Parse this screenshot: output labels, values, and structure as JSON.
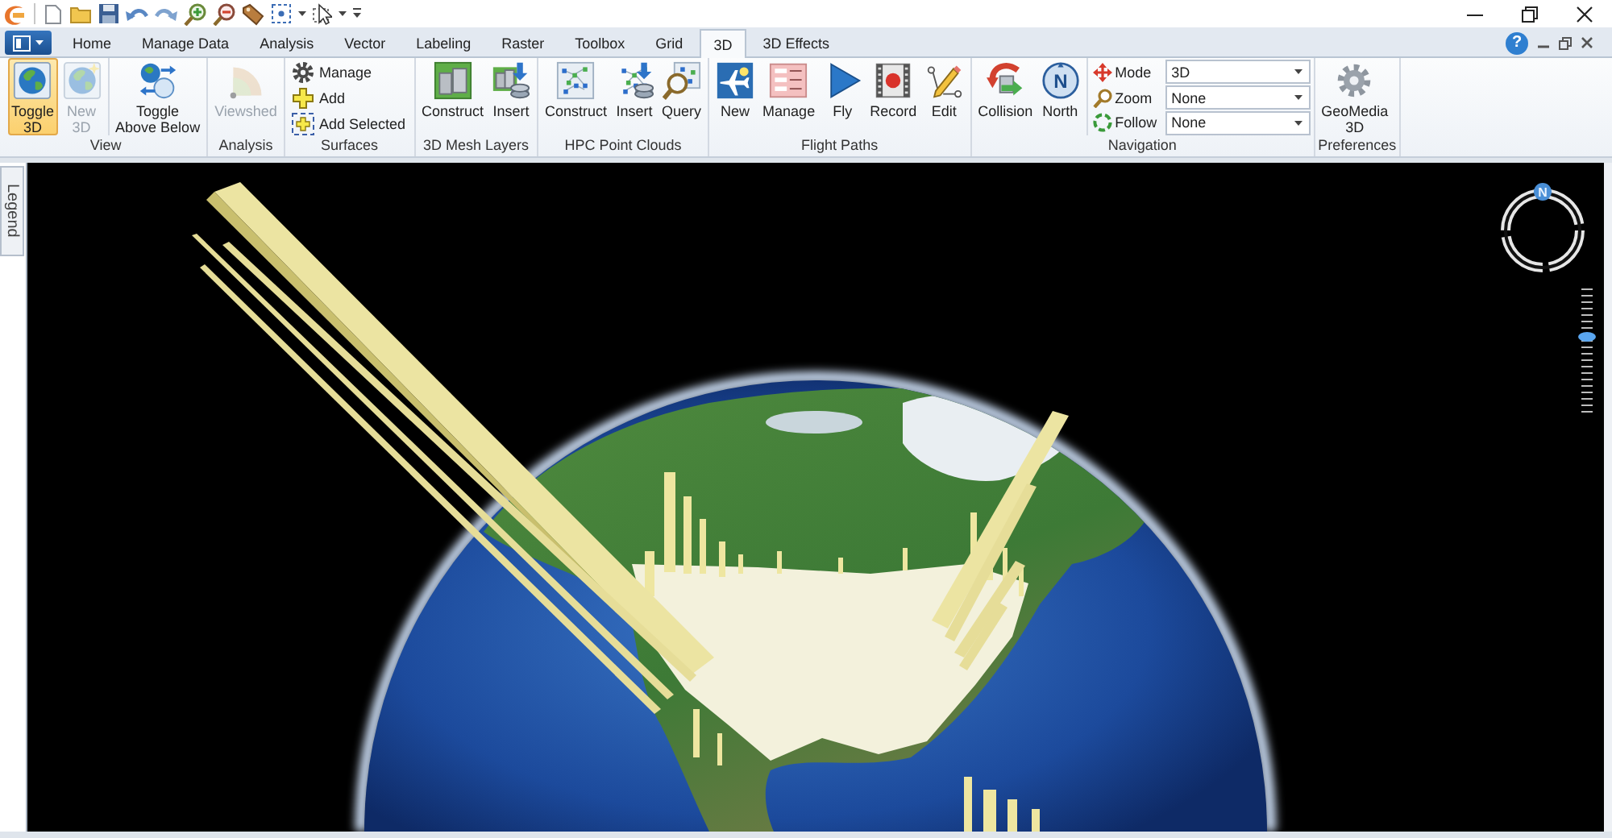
{
  "tabs": [
    {
      "label": "Home",
      "selected": false
    },
    {
      "label": "Manage Data",
      "selected": false
    },
    {
      "label": "Analysis",
      "selected": false
    },
    {
      "label": "Vector",
      "selected": false
    },
    {
      "label": "Labeling",
      "selected": false
    },
    {
      "label": "Raster",
      "selected": false
    },
    {
      "label": "Toolbox",
      "selected": false
    },
    {
      "label": "Grid",
      "selected": false
    },
    {
      "label": "3D",
      "selected": true
    },
    {
      "label": "3D Effects",
      "selected": false
    }
  ],
  "help_button": {
    "glyph": "?"
  },
  "ribbon": [
    {
      "label": "View",
      "sections": [
        {
          "items": [
            {
              "kind": "large",
              "label": "Toggle\n3D",
              "on": true,
              "disabled": false
            },
            {
              "kind": "large",
              "label": "New\n3D",
              "on": false,
              "disabled": true
            }
          ]
        },
        {
          "items": [
            {
              "kind": "large",
              "label": "Toggle\nAbove Below",
              "on": false,
              "disabled": false
            }
          ]
        }
      ]
    },
    {
      "label": "Analysis",
      "sections": [
        {
          "items": [
            {
              "kind": "large",
              "label": "Viewshed",
              "on": false,
              "disabled": true
            }
          ]
        }
      ]
    },
    {
      "label": "Surfaces",
      "sections": [
        {
          "items": [
            {
              "kind": "small",
              "label": "Manage",
              "on": false,
              "disabled": false
            },
            {
              "kind": "small",
              "label": "Add",
              "on": false,
              "disabled": false
            },
            {
              "kind": "small",
              "label": "Add Selected",
              "on": false,
              "disabled": false
            }
          ]
        }
      ]
    },
    {
      "label": "3D Mesh Layers",
      "sections": [
        {
          "items": [
            {
              "kind": "large",
              "label": "Construct",
              "on": false,
              "disabled": false
            },
            {
              "kind": "large",
              "label": "Insert",
              "on": false,
              "disabled": false
            }
          ]
        }
      ]
    },
    {
      "label": "HPC Point Clouds",
      "sections": [
        {
          "items": [
            {
              "kind": "large",
              "label": "Construct",
              "on": false,
              "disabled": false
            },
            {
              "kind": "large",
              "label": "Insert",
              "on": false,
              "disabled": false
            },
            {
              "kind": "large",
              "label": "Query",
              "on": false,
              "disabled": false
            }
          ]
        }
      ]
    },
    {
      "label": "Flight Paths",
      "sections": [
        {
          "items": [
            {
              "kind": "large",
              "label": "New",
              "on": false,
              "disabled": false
            },
            {
              "kind": "large",
              "label": "Manage",
              "on": false,
              "disabled": false
            },
            {
              "kind": "large",
              "label": "Fly",
              "on": false,
              "disabled": false
            },
            {
              "kind": "large",
              "label": "Record",
              "on": false,
              "disabled": false
            },
            {
              "kind": "large",
              "label": "Edit",
              "on": false,
              "disabled": false
            }
          ]
        }
      ]
    },
    {
      "label": "Navigation",
      "sections": [
        {
          "items": [
            {
              "kind": "large",
              "label": "Collision",
              "on": false,
              "disabled": false
            },
            {
              "kind": "large",
              "label": "North",
              "glyph": "N",
              "on": false,
              "disabled": false
            }
          ]
        },
        {
          "items": [
            {
              "kind": "combo",
              "label": "Mode",
              "value": "3D",
              "disabled": false
            },
            {
              "kind": "combo",
              "label": "Zoom",
              "value": "None",
              "disabled": false
            },
            {
              "kind": "combo",
              "label": "Follow",
              "value": "None",
              "disabled": false
            }
          ]
        }
      ]
    },
    {
      "label": "Preferences",
      "sections": [
        {
          "items": [
            {
              "kind": "large",
              "label": "GeoMedia\n3D",
              "on": false,
              "disabled": false
            }
          ]
        }
      ]
    }
  ],
  "map_view": {
    "legend_tab": "Legend",
    "compass": {
      "glyph": "N"
    },
    "zoom_slider": {
      "level": 0.6
    }
  }
}
